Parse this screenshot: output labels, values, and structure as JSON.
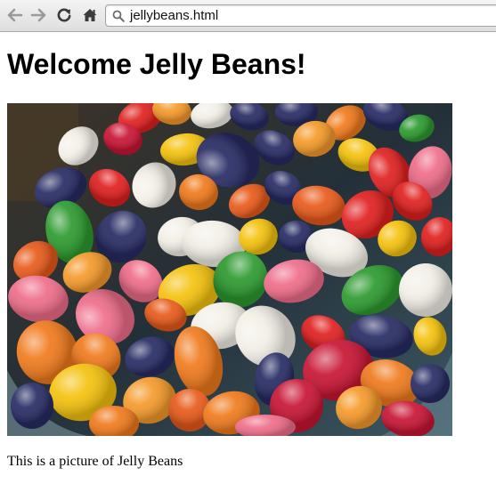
{
  "browser": {
    "address": "jellybeans.html",
    "icons": {
      "back": "back-arrow-icon",
      "forward": "forward-arrow-icon",
      "reload": "reload-icon",
      "home": "home-icon",
      "address": "search-icon"
    }
  },
  "page": {
    "heading": "Welcome Jelly Beans!",
    "image_subject": "jelly beans photo",
    "caption": "This is a picture of Jelly Beans"
  },
  "colors": {
    "toolbar_top": "#f4f4f4",
    "toolbar_bottom": "#dedede",
    "page_background": "#ffffff",
    "text": "#000000"
  }
}
